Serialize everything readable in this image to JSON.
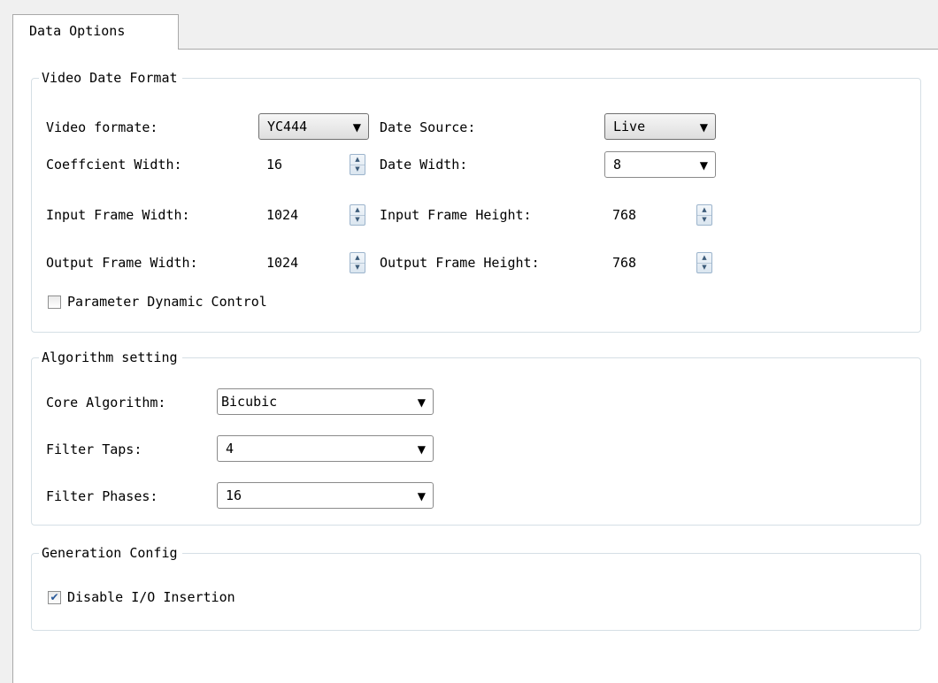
{
  "tab": {
    "label": "Data Options"
  },
  "video_group": {
    "title": "Video Date Format",
    "video_format_label": "Video formate:",
    "video_format_value": "YC444",
    "data_source_label": "Date Source:",
    "data_source_value": "Live",
    "coeff_width_label": "Coeffcient Width:",
    "coeff_width_value": "16",
    "data_width_label": "Date Width:",
    "data_width_value": "8",
    "input_width_label": "Input Frame Width:",
    "input_width_value": "1024",
    "input_height_label": "Input Frame Height:",
    "input_height_value": "768",
    "output_width_label": "Output Frame Width:",
    "output_width_value": "1024",
    "output_height_label": "Output Frame Height:",
    "output_height_value": "768",
    "dynamic_control_label": "Parameter Dynamic Control",
    "dynamic_control_checked": false
  },
  "algorithm_group": {
    "title": "Algorithm setting",
    "core_label": "Core Algorithm:",
    "core_value": "Bicubic",
    "taps_label": "Filter Taps:",
    "taps_value": "4",
    "phases_label": "Filter Phases:",
    "phases_value": "16"
  },
  "generation_group": {
    "title": "Generation Config",
    "disable_io_label": "Disable I/O Insertion",
    "disable_io_checked": true
  },
  "glyphs": {
    "dropdown": "▼",
    "spin_up": "▲",
    "spin_down": "▼",
    "check": "✔"
  }
}
